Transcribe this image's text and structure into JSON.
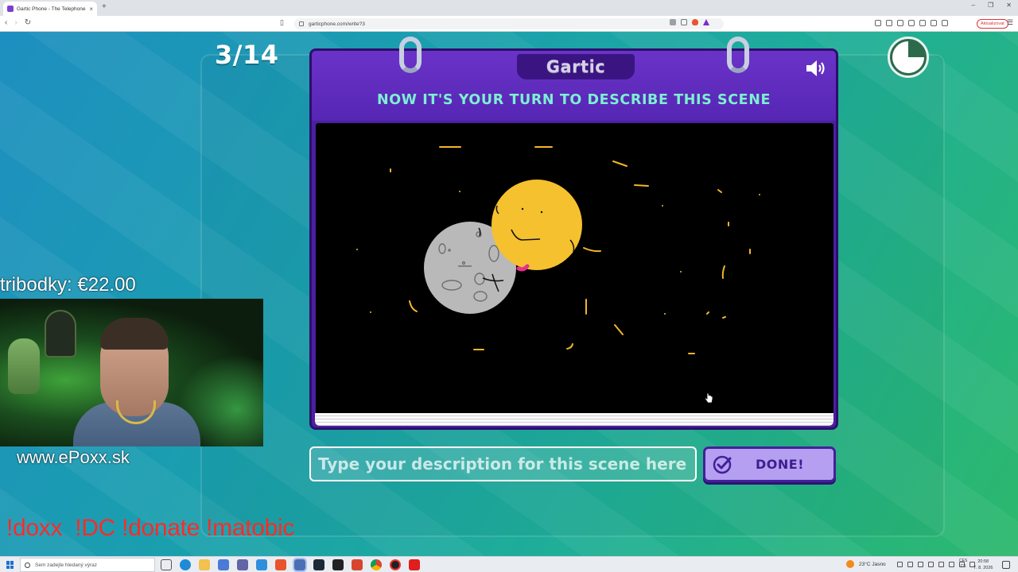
{
  "browser": {
    "tab_title": "Gartic Phone - The Telephone Ga",
    "url": "garticphone.com/write?3",
    "update_label": "Aktualizovat"
  },
  "game": {
    "round_counter": "3/14",
    "logo": "Gartic",
    "prompt": "NOW IT'S YOUR TURN TO DESCRIBE THIS SCENE",
    "description_placeholder": "Type your description for this scene here...",
    "description_value": "",
    "done_label": "DONE!",
    "timer_elapsed_fraction": 0.25
  },
  "drawing": {
    "background": "#000000",
    "sun_color": "#f6c12e",
    "moon_color": "#b9b9b9",
    "star_color": "#f2b62a"
  },
  "stream_overlay": {
    "donation": "tribodky: €22.00",
    "website": "www.ePoxx.sk",
    "commands": "!doxx  !DC !donate !matobic"
  },
  "taskbar": {
    "search_placeholder": "Sem zadejte hledaný výraz",
    "weather": "23°C  Jasno",
    "lang_top": "CES",
    "lang_bottom": "CS",
    "time": "20:58",
    "date": "7. 8. 2026"
  },
  "icons": {
    "speaker": "speaker-icon",
    "timer": "timer-icon",
    "done_check": "check-icon"
  },
  "colors": {
    "card_purple": "#4b1fa0",
    "prompt_text": "#7df0d2",
    "done_button": "#b59ff0",
    "commands_red": "#ff2a2a"
  }
}
